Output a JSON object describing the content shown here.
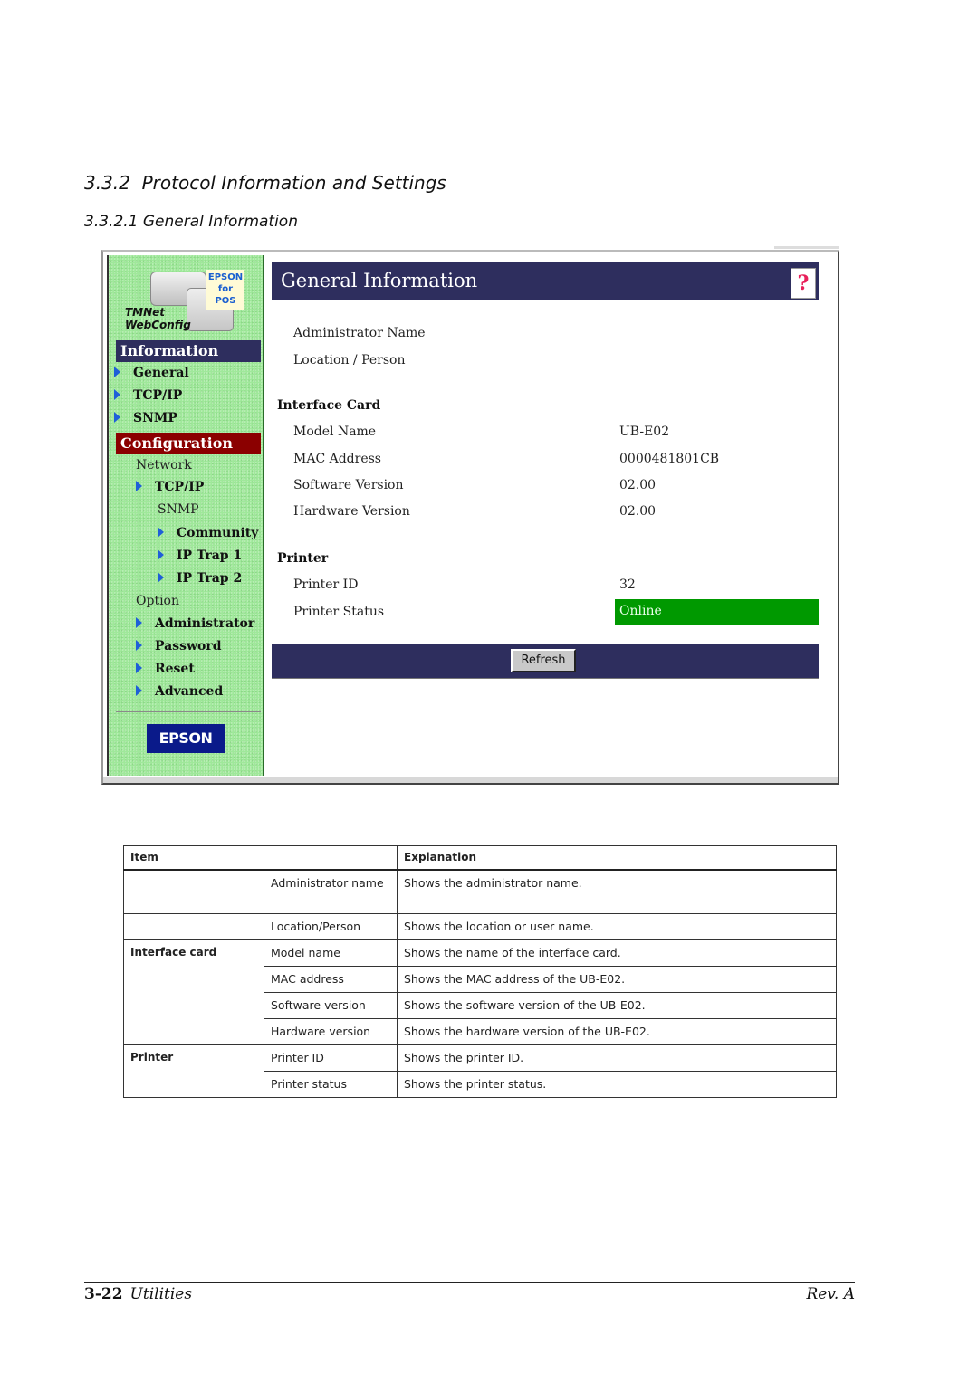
{
  "document": {
    "section_title": "3.3.2  Protocol Information and Settings",
    "subsection_title": "3.3.2.1 General Information"
  },
  "screenshot": {
    "logo": {
      "brand_tag": [
        "EPSON",
        "for",
        "POS"
      ],
      "product_line1": "TMNet",
      "product_line2": "WebConfig"
    },
    "nav": {
      "information_header": "Information",
      "information_items": [
        "General",
        "TCP/IP",
        "SNMP"
      ],
      "configuration_header": "Configuration",
      "network_label": "Network",
      "network_tcpip": "TCP/IP",
      "snmp_label": "SNMP",
      "snmp_items": [
        "Community",
        "IP Trap 1",
        "IP Trap 2"
      ],
      "option_label": "Option",
      "option_items": [
        "Administrator",
        "Password",
        "Reset",
        "Advanced"
      ],
      "footer_logo": "EPSON"
    },
    "page_title": "General Information",
    "help_icon": "?",
    "fields": {
      "administrator_name": "Administrator Name",
      "location_person": "Location / Person"
    },
    "interface_card": {
      "heading": "Interface Card",
      "rows": [
        {
          "label": "Model Name",
          "value": "UB-E02"
        },
        {
          "label": "MAC Address",
          "value": "0000481801CB"
        },
        {
          "label": "Software Version",
          "value": "02.00"
        },
        {
          "label": "Hardware Version",
          "value": "02.00"
        }
      ]
    },
    "printer": {
      "heading": "Printer",
      "rows": [
        {
          "label": "Printer ID",
          "value": "32"
        },
        {
          "label": "Printer Status",
          "value": "Online"
        }
      ],
      "status_color": "#009900"
    },
    "refresh_button": "Refresh",
    "colors": {
      "nav_bg": "#9fe89a",
      "header_navy": "#2e2e5e",
      "config_red": "#8b0000"
    }
  },
  "table": {
    "headers": {
      "item": "Item",
      "explanation": "Explanation"
    },
    "rows": [
      {
        "group": "",
        "item": "Administrator name",
        "explanation": "Shows the administrator name."
      },
      {
        "group": "",
        "item": "Location/Person",
        "explanation": "Shows the location or user name."
      },
      {
        "group": "Interface card",
        "item": "Model name",
        "explanation": "Shows the name of the interface card."
      },
      {
        "group": "",
        "item": "MAC address",
        "explanation": "Shows the MAC address of the UB-E02."
      },
      {
        "group": "",
        "item": "Software version",
        "explanation": "Shows the software version of the UB-E02."
      },
      {
        "group": "",
        "item": "Hardware version",
        "explanation": "Shows the hardware version of the UB-E02."
      },
      {
        "group": "Printer",
        "item": "Printer ID",
        "explanation": "Shows the printer ID."
      },
      {
        "group": "",
        "item": "Printer status",
        "explanation": "Shows the printer status."
      }
    ]
  },
  "footer": {
    "page_number": "3-22",
    "chapter": "Utilities",
    "revision": "Rev. A"
  }
}
